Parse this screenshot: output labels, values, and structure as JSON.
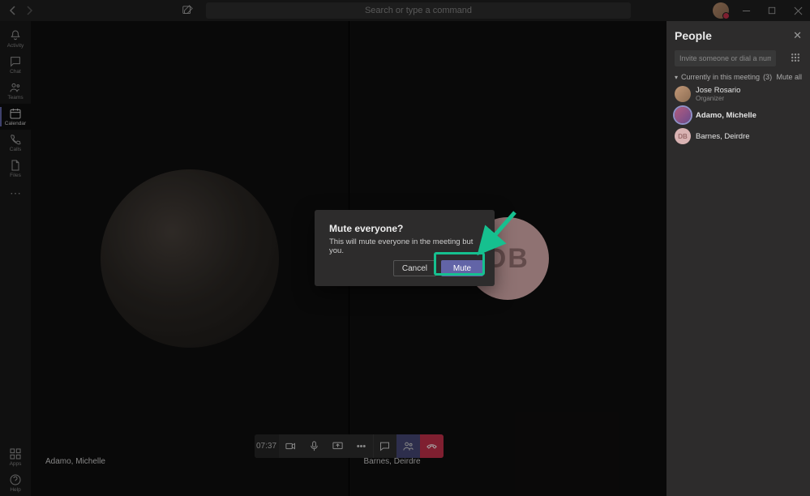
{
  "titlebar": {
    "search_placeholder": "Search or type a command"
  },
  "rail": {
    "activity": "Activity",
    "chat": "Chat",
    "teams": "Teams",
    "calendar": "Calendar",
    "calls": "Calls",
    "files": "Files",
    "apps": "Apps",
    "help": "Help"
  },
  "call": {
    "timer": "07:37",
    "tiles": [
      {
        "name": "Adamo, Michelle"
      },
      {
        "name": "Barnes, Deirdre"
      }
    ]
  },
  "people": {
    "title": "People",
    "invite_placeholder": "Invite someone or dial a number",
    "section_label": "Currently in this meeting",
    "section_count": "(3)",
    "mute_all_label": "Mute all",
    "list": [
      {
        "name": "Jose Rosario",
        "role": "Organizer",
        "avatar": "photo1",
        "initials": ""
      },
      {
        "name": "Adamo, Michelle",
        "role": "",
        "avatar": "photo2",
        "initials": "",
        "speaking": true
      },
      {
        "name": "Barnes, Deirdre",
        "role": "",
        "avatar": "init",
        "initials": "DB"
      }
    ]
  },
  "dialog": {
    "title": "Mute everyone?",
    "body": "This will mute everyone in the meeting but you.",
    "cancel": "Cancel",
    "mute": "Mute"
  },
  "avatar_initials": {
    "db": "DB"
  }
}
